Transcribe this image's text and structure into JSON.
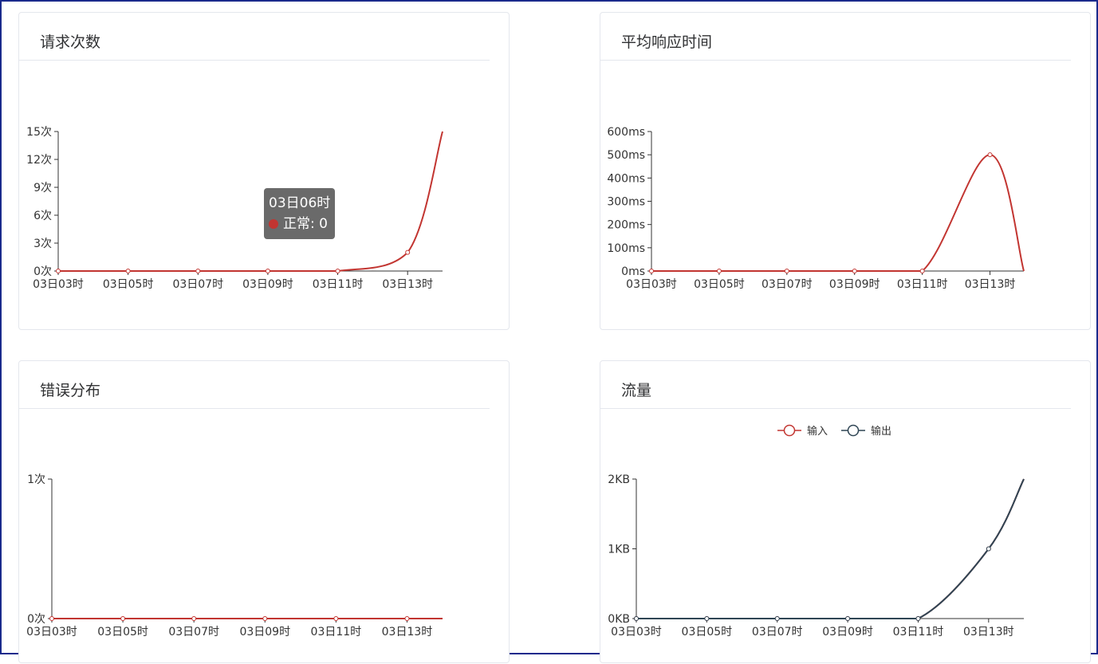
{
  "panels": {
    "requests": {
      "title": "请求次数"
    },
    "response": {
      "title": "平均响应时间"
    },
    "errors": {
      "title": "错误分布"
    },
    "traffic": {
      "title": "流量"
    }
  },
  "tooltip": {
    "time": "03日06时",
    "series": "正常",
    "value": "0",
    "color": "#c23531"
  },
  "chart_data": [
    {
      "id": "requests",
      "type": "line",
      "title": "请求次数",
      "x": [
        "03日03时",
        "03日05时",
        "03日07时",
        "03日09时",
        "03日11时",
        "03日13时"
      ],
      "y_ticks": [
        "0次",
        "3次",
        "6次",
        "9次",
        "12次",
        "15次"
      ],
      "ylim": [
        0,
        15
      ],
      "series": [
        {
          "color": "#c23531",
          "points": [
            [
              0,
              0
            ],
            [
              2,
              0
            ],
            [
              4,
              0
            ],
            [
              6,
              0
            ],
            [
              8,
              0
            ],
            [
              10,
              2
            ],
            [
              11,
              15
            ]
          ]
        }
      ]
    },
    {
      "id": "response",
      "type": "line",
      "title": "平均响应时间",
      "x": [
        "03日03时",
        "03日05时",
        "03日07时",
        "03日09时",
        "03日11时",
        "03日13时"
      ],
      "y_ticks": [
        "0ms",
        "100ms",
        "200ms",
        "300ms",
        "400ms",
        "500ms",
        "600ms"
      ],
      "ylim": [
        0,
        600
      ],
      "series": [
        {
          "color": "#c23531",
          "points": [
            [
              0,
              0
            ],
            [
              2,
              0
            ],
            [
              4,
              0
            ],
            [
              6,
              0
            ],
            [
              8,
              0
            ],
            [
              10,
              500
            ],
            [
              11,
              0
            ]
          ]
        }
      ]
    },
    {
      "id": "errors",
      "type": "line",
      "title": "错误分布",
      "x": [
        "03日03时",
        "03日05时",
        "03日07时",
        "03日09时",
        "03日11时",
        "03日13时"
      ],
      "y_ticks": [
        "0次",
        "1次"
      ],
      "ylim": [
        0,
        1
      ],
      "series": [
        {
          "color": "#c23531",
          "points": [
            [
              0,
              0
            ],
            [
              2,
              0
            ],
            [
              4,
              0
            ],
            [
              6,
              0
            ],
            [
              8,
              0
            ],
            [
              10,
              0
            ],
            [
              11,
              0
            ]
          ]
        }
      ]
    },
    {
      "id": "traffic",
      "type": "line",
      "title": "流量",
      "x": [
        "03日03时",
        "03日05时",
        "03日07时",
        "03日09时",
        "03日11时",
        "03日13时"
      ],
      "y_ticks": [
        "0KB",
        "1KB",
        "2KB"
      ],
      "ylim": [
        0,
        2
      ],
      "legend": [
        "输入",
        "输出"
      ],
      "series": [
        {
          "name": "输入",
          "color": "#c23531",
          "points": [
            [
              0,
              0
            ],
            [
              2,
              0
            ],
            [
              4,
              0
            ],
            [
              6,
              0
            ],
            [
              8,
              0
            ],
            [
              10,
              1
            ],
            [
              11,
              2
            ]
          ]
        },
        {
          "name": "输出",
          "color": "#2f4554",
          "points": [
            [
              0,
              0
            ],
            [
              2,
              0
            ],
            [
              4,
              0
            ],
            [
              6,
              0
            ],
            [
              8,
              0
            ],
            [
              10,
              1
            ],
            [
              11,
              2
            ]
          ]
        }
      ]
    }
  ]
}
